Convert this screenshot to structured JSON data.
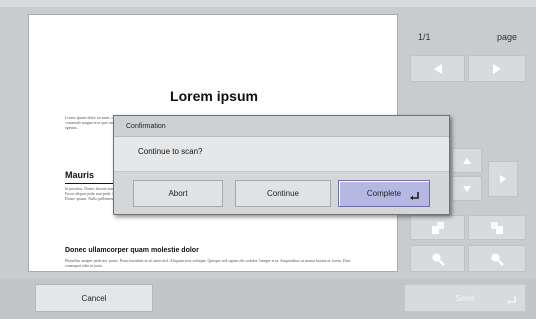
{
  "preview": {
    "title": "Lorem ipsum",
    "para1": "Lorem ipsum dolor sit amet, consectetuer adipiscing elit. Maecenas porttitor congue massa. Fusce posuere, magna sed pulvinar ultricies, purus lectus malesuada libero, sit amet commodo magna eros quis urna. Nunc viverra imperdiet enim. Fusce est. Vivamus a tellus. Pellentesque habitant morbi tristique senectus et netus et malesuada fames ac turpis egestas.",
    "heading2": "Mauris",
    "para2": "In porttitor. Donec laoreet nonummy augue. Suspendisse dui purus, scelerisque at, vulputate vitae, pretium mattis, nunc. Mauris eget neque at sem venenatis eleifend. Ut nonummy. Fusce aliquet pede non pede. Suspendisse dapibus lorem pellentesque magna. Integer nulla. Mauris sed nisi, non lit vitae, semper at, vivamus hendrerit, justo. Curabitur nec neque. Donec ipsum. Nullo pellentesque semper turpis. Morbi in nisi. Quisque nisl.",
    "heading3": "Donec ullamcorper quam molestie dolor",
    "para3": "Phasellus semper pede nec purus. Proin tincidunt ut sit amet nisl. Aliquam eros volutpat. Quisque sed sapien elit sodales. Integer eros. Suspendisse ut massa lacinia ut lorem. Duis consequat odio ut justo."
  },
  "pager": {
    "current": "1/1",
    "label": "page"
  },
  "dialog": {
    "title": "Confirmation",
    "message": "Continue to scan?",
    "abort_label": "Abort",
    "continue_label": "Continue",
    "complete_label": "Complete"
  },
  "bottom": {
    "cancel_label": "Cancel",
    "send_label": "Send"
  },
  "icons": {
    "prev": "triangle-left-icon",
    "next": "triangle-right-icon",
    "up": "triangle-up-icon",
    "down": "triangle-down-icon",
    "rotate_left": "rotate-left-icon",
    "rotate_right": "rotate-right-icon",
    "zoom_out": "zoom-out-icon",
    "zoom_in": "zoom-in-icon",
    "enter": "enter-icon"
  },
  "colors": {
    "primary_button": "#b6b8e4",
    "disabled_control": "#d8dbdd"
  }
}
